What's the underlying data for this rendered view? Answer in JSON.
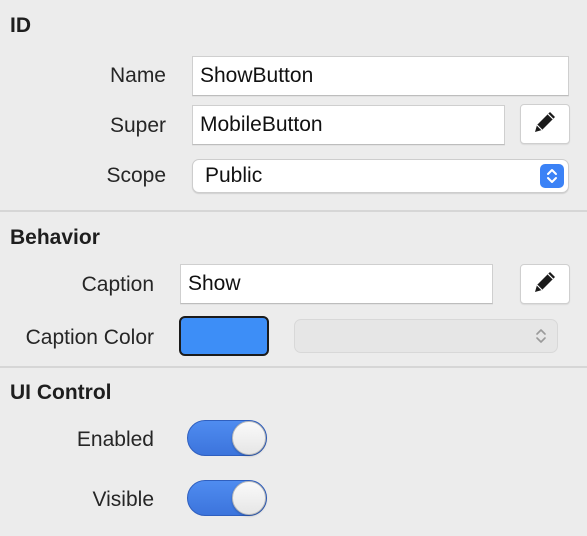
{
  "sections": {
    "id": {
      "title": "ID",
      "name": {
        "label": "Name",
        "value": "ShowButton"
      },
      "super": {
        "label": "Super",
        "value": "MobileButton"
      },
      "scope": {
        "label": "Scope",
        "value": "Public"
      }
    },
    "behavior": {
      "title": "Behavior",
      "caption": {
        "label": "Caption",
        "value": "Show"
      },
      "caption_color": {
        "label": "Caption Color",
        "color": "#3d8ef7",
        "selected": ""
      }
    },
    "ui_control": {
      "title": "UI Control",
      "enabled": {
        "label": "Enabled",
        "on": true
      },
      "visible": {
        "label": "Visible",
        "on": true
      }
    }
  },
  "icons": {
    "edit": "pencil-icon",
    "select_arrows": "updown-chevron-icon"
  },
  "colors": {
    "accent": "#3b82f6",
    "panel_bg": "#ececec"
  }
}
